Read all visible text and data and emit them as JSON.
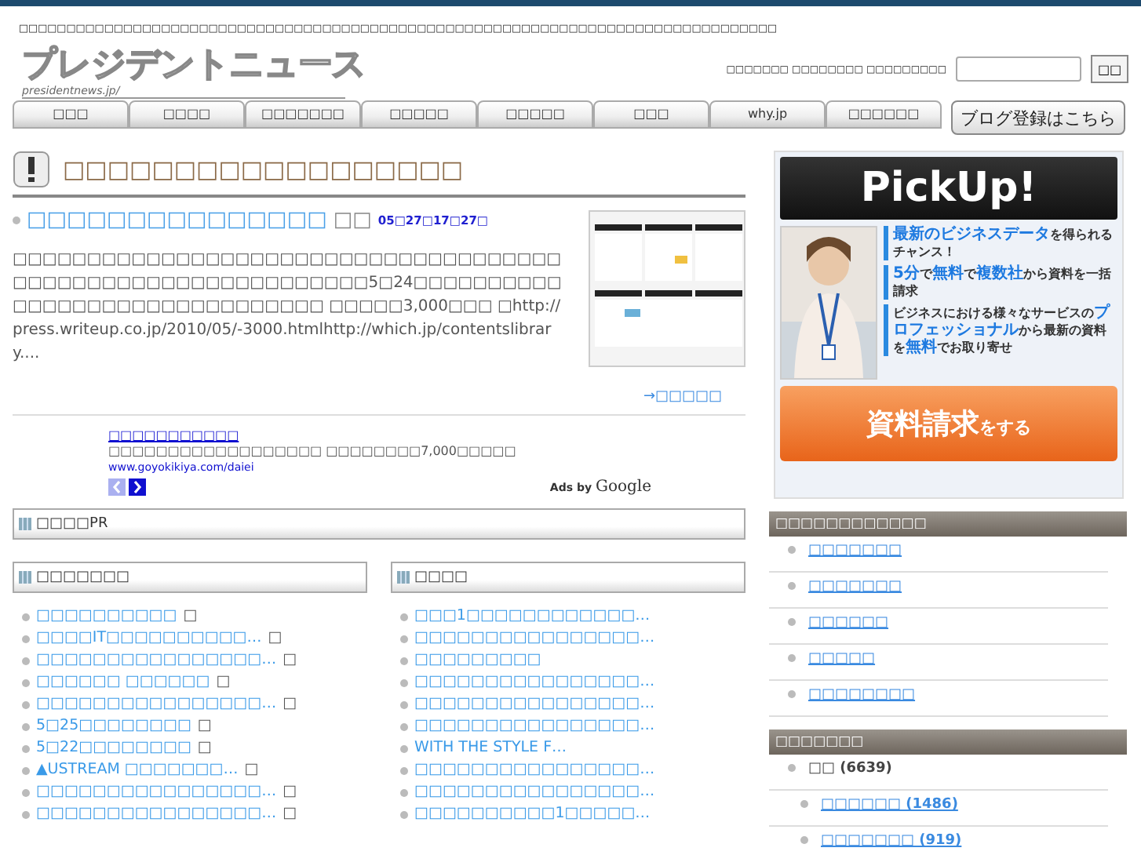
{
  "top_text": "□□□□□□□□□□□□□□□□□□□□□□□□□□□□□□□□□□□□□□□□□□□□□□□□□□□□□□□□□□□□□□□□□□□□□□□□□□□□□□□□",
  "logo": {
    "title": "プレジデントニュース",
    "subtitle": "presidentnews.jp/"
  },
  "search": {
    "label": "□□□□□□□ □□□□□□□□ □□□□□□□□□",
    "button": "□□"
  },
  "nav": [
    "□□□",
    "□□□□",
    "□□□□□□□",
    "□□□□□",
    "□□□□□",
    "□□□",
    "why.jp",
    "□□□□□□"
  ],
  "blog_button": "ブログ登録はこちら",
  "heading": "□□□□□□□□□□□□□□□□□□",
  "article": {
    "title": "□□□□□□□□□□□□□□□",
    "author": "□□",
    "date": "05□27□17□27□",
    "body": "□□□□□□□□□□□□□□□□□□□□□□□□□□□□□□□□□□□□□□□□□□□□□□□□□□□□□□□□□□□□□5□24□□□□□□□□□□□□□□□□□□□□□□□□□□□□□□□ □□□□□3,000□□□ □http://press.writeup.co.jp/2010/05/-3000.htmlhttp://which.jp/contentslibrary....",
    "more": "→□□□□□"
  },
  "ad": {
    "title": "□□□□□□□□□□□",
    "text": "□□□□□□□□□□□□□□□□□□ □□□□□□□□7,000□□□□□",
    "url": "www.goyokikiya.com/daiei",
    "credit": "Ads by",
    "brand": "Google"
  },
  "pr_header": "□□□□PR",
  "columns": [
    {
      "header": "□□□□□□□",
      "items": [
        {
          "title": "□□□□□□□□□□",
          "suffix": "□"
        },
        {
          "title": "□□□□IT□□□□□□□□□□…",
          "suffix": "□"
        },
        {
          "title": "□□□□□□□□□□□□□□□□…",
          "suffix": "□"
        },
        {
          "title": "□□□□□□ □□□□□□",
          "suffix": "□"
        },
        {
          "title": "□□□□□□□□□□□□□□□□…",
          "suffix": "□"
        },
        {
          "title": "5□25□□□□□□□□",
          "suffix": "□"
        },
        {
          "title": "5□22□□□□□□□□",
          "suffix": "□"
        },
        {
          "title": "▲USTREAM □□□□□□□…",
          "suffix": "□"
        },
        {
          "title": "□□□□□□□□□□□□□□□□…",
          "suffix": "□"
        },
        {
          "title": "□□□□□□□□□□□□□□□□…",
          "suffix": "□"
        }
      ]
    },
    {
      "header": "□□□□",
      "items": [
        {
          "title": "□□□1□□□□□□□□□□□□…"
        },
        {
          "title": "□□□□□□□□□□□□□□□□…"
        },
        {
          "title": "□□□□□□□□□"
        },
        {
          "title": "□□□□□□□□□□□□□□□□…"
        },
        {
          "title": "□□□□□□□□□□□□□□□□…"
        },
        {
          "title": "□□□□□□□□□□□□□□□□…"
        },
        {
          "title": "WITH THE STYLE F…"
        },
        {
          "title": "□□□□□□□□□□□□□□□□…"
        },
        {
          "title": "□□□□□□□□□□□□□□□□…"
        },
        {
          "title": "□□□□□□□□□□1□□□□□…"
        }
      ]
    }
  ],
  "banner": {
    "title": "PickUp!",
    "blocks": [
      "**最新のビジネスデータ**を得られるチャンス！",
      "**5分**で**無料**で**複数社**から資料を一括請求",
      "ビジネスにおける様々なサービスの**プロフェッショナル**から最新の資料を**無料**でお取り寄せ"
    ],
    "button": "**資料請求**をする"
  },
  "sidebar": [
    {
      "header": "□□□□□□□□□□□□",
      "items": [
        {
          "label": "□□□□□□□"
        },
        {
          "label": "□□□□□□□"
        },
        {
          "label": "□□□□□□"
        },
        {
          "label": "□□□□□"
        },
        {
          "label": "□□□□□□□□"
        }
      ]
    },
    {
      "header": "□□□□□□□",
      "items": [
        {
          "label": "□□ (6639)",
          "children": [
            {
              "label": "□□□□□□ (1486)"
            },
            {
              "label": "□□□□□□□ (919)"
            }
          ]
        }
      ]
    }
  ]
}
